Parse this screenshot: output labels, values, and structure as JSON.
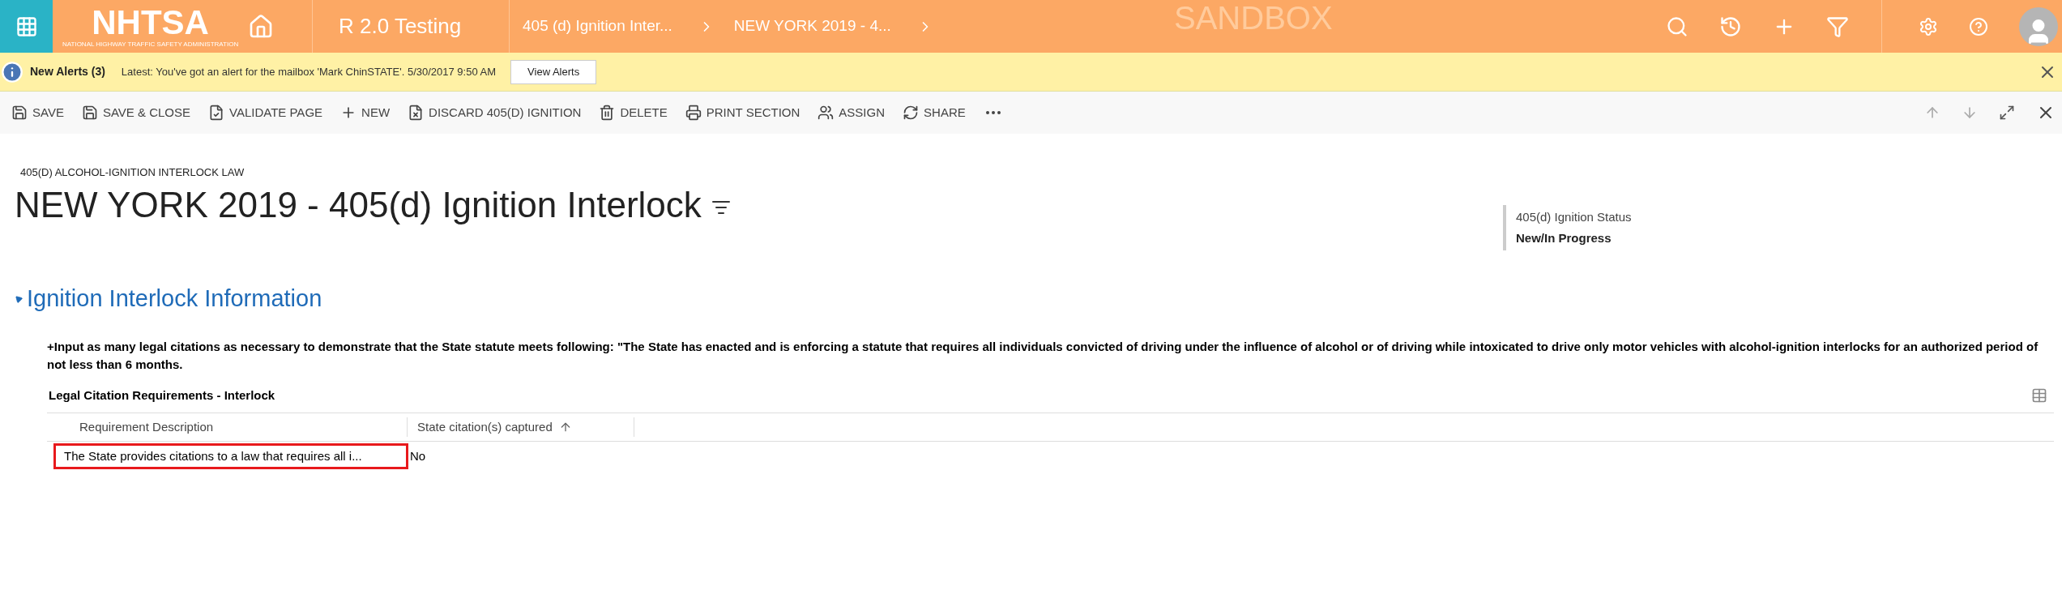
{
  "nav": {
    "logo_text": "NHTSA",
    "logo_subtitle": "NATIONAL HIGHWAY TRAFFIC SAFETY ADMINISTRATION",
    "app_name": "R 2.0 Testing",
    "breadcrumbs": [
      "405 (d) Ignition Inter...",
      "NEW YORK 2019 - 4..."
    ],
    "watermark": "SANDBOX"
  },
  "alert": {
    "title": "New Alerts (3)",
    "message": "Latest: You've got an alert for the mailbox 'Mark ChinSTATE'. 5/30/2017 9:50 AM",
    "button": "View Alerts"
  },
  "toolbar": [
    {
      "kind": "save",
      "label": "SAVE"
    },
    {
      "kind": "save-close",
      "label": "SAVE & CLOSE"
    },
    {
      "kind": "validate",
      "label": "VALIDATE PAGE"
    },
    {
      "kind": "new",
      "label": "NEW"
    },
    {
      "kind": "discard",
      "label": "DISCARD 405(D) IGNITION"
    },
    {
      "kind": "delete",
      "label": "DELETE"
    },
    {
      "kind": "print",
      "label": "PRINT SECTION"
    },
    {
      "kind": "assign",
      "label": "ASSIGN"
    },
    {
      "kind": "share",
      "label": "SHARE"
    }
  ],
  "record": {
    "entity": "405(D) ALCOHOL-IGNITION INTERLOCK LAW",
    "title": "NEW YORK 2019 - 405(d) Ignition Interlock",
    "status_label": "405(d) Ignition Status",
    "status_value": "New/In Progress"
  },
  "section": {
    "title": "Ignition Interlock Information",
    "expanded": true,
    "instruction": "+Input as many legal citations as necessary to demonstrate that the State statute meets following: \"The State has enacted and is enforcing a statute that requires all individuals convicted of driving under the influence of alcohol or of driving while intoxicated to drive only motor vehicles with alcohol-ignition interlocks for an authorized period of not less than 6 months.",
    "subgrid": {
      "title": "Legal Citation Requirements - Interlock",
      "columns": [
        "Requirement Description",
        "State citation(s) captured"
      ],
      "rows": [
        {
          "cells": [
            "The State provides citations to a law that requires all i...",
            "No"
          ],
          "selected": true
        }
      ]
    }
  }
}
